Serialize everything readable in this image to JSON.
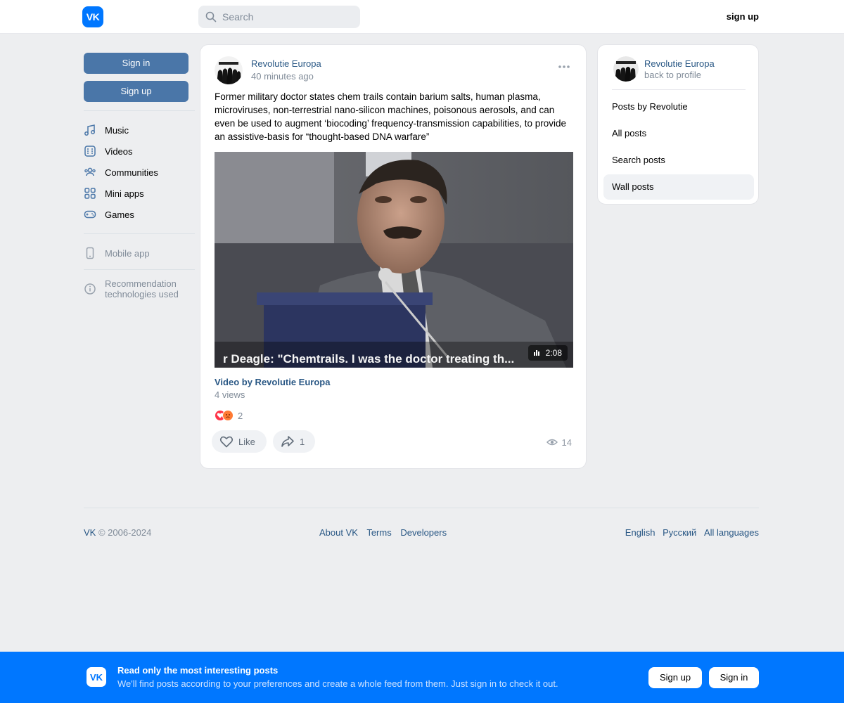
{
  "header": {
    "logo_text": "VK",
    "search_placeholder": "Search",
    "signup_label": "sign up"
  },
  "left_nav": {
    "signin_label": "Sign in",
    "signup_label": "Sign up",
    "items": [
      {
        "label": "Music",
        "icon": "music-note-icon"
      },
      {
        "label": "Videos",
        "icon": "video-icon"
      },
      {
        "label": "Communities",
        "icon": "users-icon"
      },
      {
        "label": "Mini apps",
        "icon": "apps-grid-icon"
      },
      {
        "label": "Games",
        "icon": "gamepad-icon"
      }
    ],
    "mobile_app_label": "Mobile app",
    "recommendation_line1": "Recommendation",
    "recommendation_line2": "technologies used"
  },
  "post": {
    "author": "Revolutie Europa",
    "time": "40 minutes ago",
    "text": "Former military doctor states chem trails contain barium salts, human plasma, microviruses, non-terrestrial nano-silicon machines, poisonous aerosols, and can even be used to augment ‘biocoding’ frequency-transmission capabilities, to provide an assistive-basis for “thought-based DNA warfare”",
    "video": {
      "caption": "r Deagle: \"Chemtrails. I was the doctor treating th...",
      "duration": "2:08",
      "title": "Video by Revolutie Europa",
      "views": "4 views"
    },
    "reactions_count": "2",
    "like_label": "Like",
    "share_count": "1",
    "view_count": "14"
  },
  "right_panel": {
    "name": "Revolutie Europa",
    "back_label": "back to profile",
    "items": [
      {
        "label": "Posts by Revolutie",
        "active": false
      },
      {
        "label": "All posts",
        "active": false
      },
      {
        "label": "Search posts",
        "active": false
      },
      {
        "label": "Wall posts",
        "active": true
      }
    ]
  },
  "footer": {
    "brand": "VK",
    "copyright": "© 2006-2024",
    "links": [
      "About VK",
      "Terms",
      "Developers"
    ],
    "languages": [
      "English",
      "Русский",
      "All languages"
    ]
  },
  "banner": {
    "logo_text": "VK",
    "title": "Read only the most interesting posts",
    "subtitle": "We'll find posts according to your preferences and create a whole feed from them. Just sign in to check it out.",
    "signup_label": "Sign up",
    "signin_label": "Sign in"
  },
  "colors": {
    "brand_blue": "#0077ff",
    "button_blue": "#4a76a8",
    "link_blue": "#2a5885",
    "background": "#edeef0"
  }
}
